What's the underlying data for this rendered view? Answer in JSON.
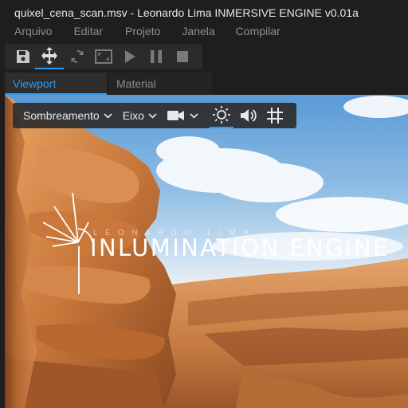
{
  "window": {
    "title": "quixel_cena_scan.msv - Leonardo Lima INMERSIVE ENGINE v0.01a"
  },
  "menubar": {
    "items": [
      "Arquivo",
      "Editar",
      "Projeto",
      "Janela",
      "Compilar"
    ]
  },
  "toolbar": {
    "icons": [
      "save-icon",
      "move-icon",
      "refresh-icon",
      "maximize-icon",
      "play-icon",
      "pause-icon",
      "stop-icon"
    ],
    "active": "move-icon",
    "accent": "#2f9bf0"
  },
  "tabs": [
    {
      "label": "Viewport",
      "active": true
    },
    {
      "label": "Material",
      "active": false
    }
  ],
  "viewport": {
    "toolbar": {
      "shading_label": "Sombreamento",
      "axis_label": "Eixo",
      "icons": [
        "camera-icon",
        "chevron-down-icon",
        "sun-icon",
        "speaker-icon",
        "grid-icon"
      ],
      "active": "sun-icon"
    },
    "logo": {
      "subtitle": "LEONARDO LIMA",
      "title": "INLUMINATION ENGINE"
    }
  }
}
